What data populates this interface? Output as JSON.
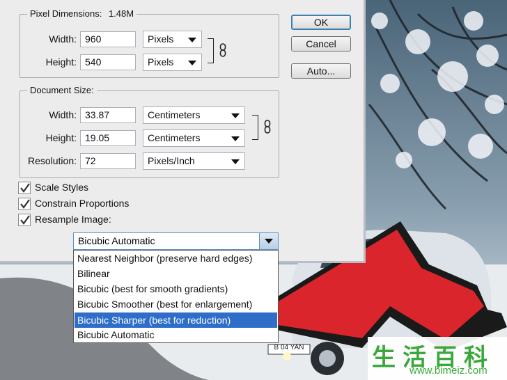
{
  "pixel_dimensions": {
    "legend": "Pixel Dimensions:",
    "size": "1.48M",
    "width_label": "Width:",
    "width_value": "960",
    "width_unit": "Pixels",
    "height_label": "Height:",
    "height_value": "540",
    "height_unit": "Pixels"
  },
  "document_size": {
    "legend": "Document Size:",
    "width_label": "Width:",
    "width_value": "33.87",
    "width_unit": "Centimeters",
    "height_label": "Height:",
    "height_value": "19.05",
    "height_unit": "Centimeters",
    "resolution_label": "Resolution:",
    "resolution_value": "72",
    "resolution_unit": "Pixels/Inch"
  },
  "buttons": {
    "ok": "OK",
    "cancel": "Cancel",
    "auto": "Auto..."
  },
  "checkboxes": [
    {
      "label": "Scale Styles",
      "checked": true
    },
    {
      "label": "Constrain Proportions",
      "checked": true
    },
    {
      "label": "Resample Image:",
      "checked": true
    }
  ],
  "resample": {
    "selected": "Bicubic Automatic",
    "options": [
      "Nearest Neighbor (preserve hard edges)",
      "Bilinear",
      "Bicubic (best for smooth gradients)",
      "Bicubic Smoother (best for enlargement)",
      "Bicubic Sharper (best for reduction)",
      "Bicubic Automatic"
    ],
    "highlighted": "Bicubic Sharper (best for reduction)"
  },
  "background": {
    "plate_text": "B 04 YAN"
  },
  "colors": {
    "arrow_red": "#d9252b",
    "highlight": "#2e6ec8",
    "watermark": "#3aa83a"
  },
  "watermark": {
    "chars": "生活百科",
    "url": "www.bimeiz.com"
  }
}
